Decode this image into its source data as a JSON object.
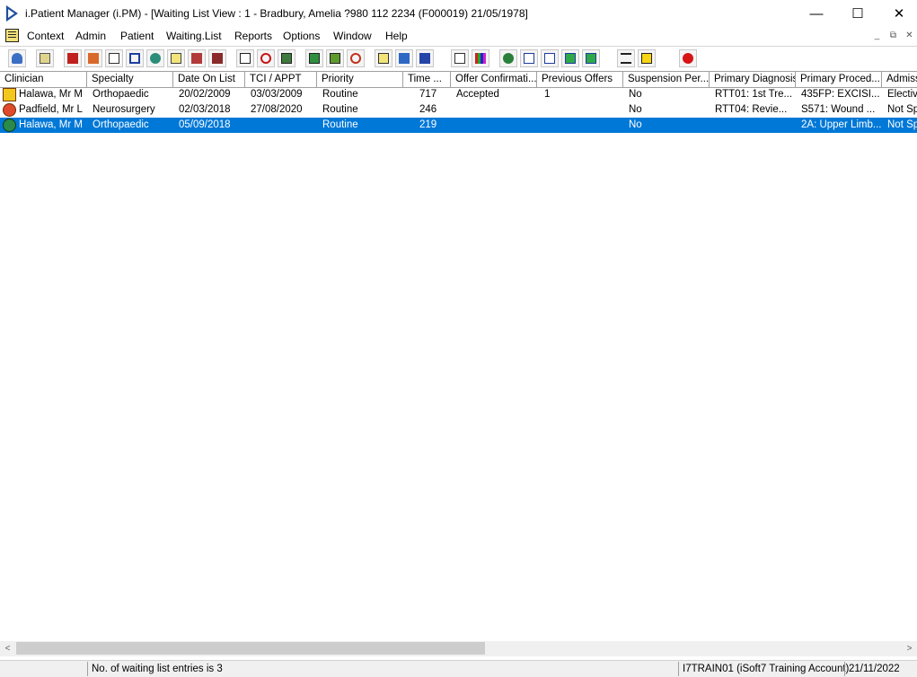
{
  "window": {
    "title": "i.Patient Manager (i.PM) - [Waiting List View :  1 - Bradbury, Amelia ?980 112 2234 (F000019) 21/05/1978]",
    "minimize": "—",
    "maximize": "☐",
    "close": "✕"
  },
  "menu": {
    "items": [
      "Context",
      "Admin",
      "Patient",
      "Waiting.List",
      "Reports",
      "Options",
      "Window",
      "Help"
    ],
    "mdi": [
      "_",
      "⧉",
      "✕"
    ]
  },
  "toolbar": {
    "icons": [
      "user-icon",
      "print-icon",
      "book-icon",
      "patient-edit-icon",
      "form-icon",
      "m-letter-icon",
      "doctor-icon",
      "note-icon",
      "bed-icon",
      "ambulance-icon",
      "search-doc-icon",
      "clock-icon",
      "monitor-icon",
      "card-icon",
      "card-edit-icon",
      "disc-icon",
      "list-icon",
      "transfer-icon",
      "envelope-icon",
      "page-icon",
      "chart-icon",
      "globe-icon",
      "message-icon",
      "message-check-icon",
      "message-down-icon",
      "message-refresh-icon",
      "swap-icon",
      "warning-icon",
      "exit-icon"
    ]
  },
  "table": {
    "columns": [
      "Clinician",
      "Specialty",
      "Date On List",
      "TCI / APPT",
      "Priority",
      "Time ...",
      "Offer Confirmati...",
      "Previous Offers",
      "Suspension Per...",
      "Primary Diagnosis",
      "Primary Proced...",
      "Admiss"
    ],
    "rows": [
      {
        "clinician": "Halawa, Mr M",
        "specialty": "Orthopaedic",
        "date_on_list": "20/02/2009",
        "tci": "03/03/2009",
        "priority": "Routine",
        "time": "717",
        "offer": "Accepted",
        "previous": "1",
        "suspension": "No",
        "diagnosis": "RTT01: 1st Tre...",
        "procedure": "435FP: EXCISI...",
        "admiss": "Electiv",
        "icon": "waiting-list-entry-icon"
      },
      {
        "clinician": "Padfield, Mr L",
        "specialty": "Neurosurgery",
        "date_on_list": "02/03/2018",
        "tci": "27/08/2020",
        "priority": "Routine",
        "time": "246",
        "offer": "",
        "previous": "",
        "suspension": "No",
        "diagnosis": "RTT04: Revie...",
        "procedure": "S571: Wound ...",
        "admiss": "Not Sp",
        "icon": "entry-warning-icon"
      },
      {
        "clinician": "Halawa, Mr M",
        "specialty": "Orthopaedic",
        "date_on_list": "05/09/2018",
        "tci": "",
        "priority": "Routine",
        "time": "219",
        "offer": "",
        "previous": "",
        "suspension": "No",
        "diagnosis": "",
        "procedure": "2A: Upper Limb...",
        "admiss": "Not Sp",
        "icon": "entry-globe-icon"
      }
    ]
  },
  "scroll": {
    "left": "<",
    "right": ">"
  },
  "status": {
    "entries": "No. of waiting list entries is 3",
    "account": "I7TRAIN01 (iSoft7 Training Account)",
    "date": "21/11/2022"
  }
}
